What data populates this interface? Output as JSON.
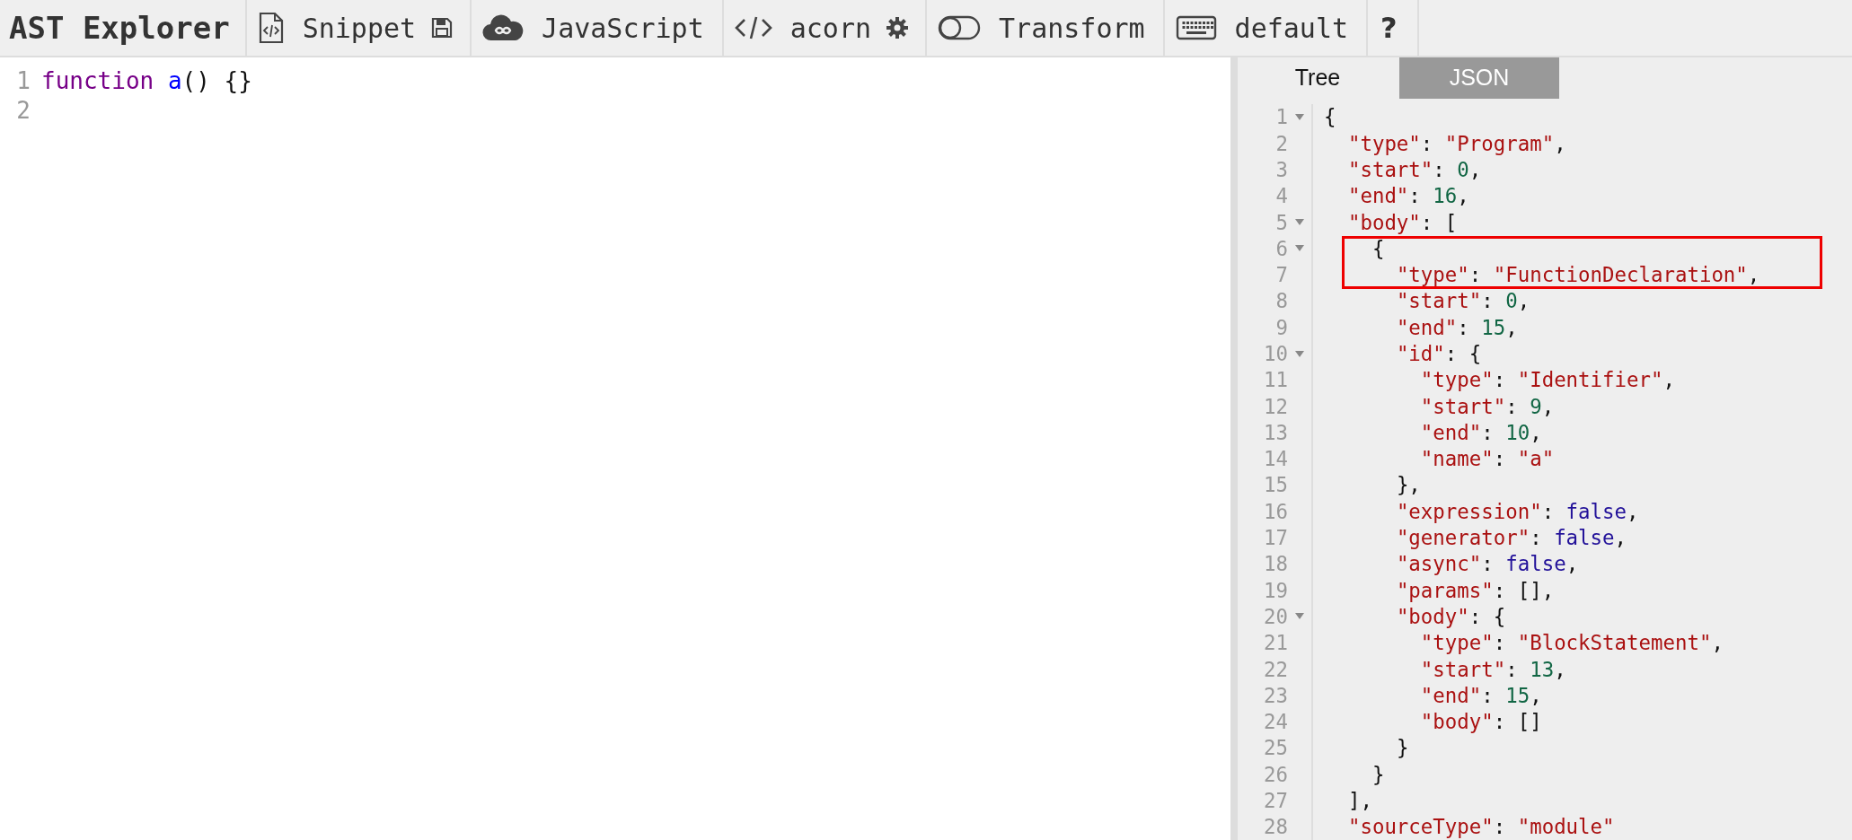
{
  "toolbar": {
    "logo": "AST Explorer",
    "items": [
      {
        "kind": "snippet",
        "label": "Snippet"
      },
      {
        "kind": "language",
        "label": "JavaScript"
      },
      {
        "kind": "parser",
        "label": "acorn"
      },
      {
        "kind": "transform",
        "label": "Transform",
        "on": false
      },
      {
        "kind": "keymap",
        "label": "default"
      },
      {
        "kind": "help",
        "label": "?"
      }
    ]
  },
  "editor": {
    "lines": [
      {
        "number": "1",
        "tokens": [
          {
            "kind": "keyword",
            "text": "function"
          },
          {
            "kind": "def",
            "text": "a"
          },
          {
            "kind": "p",
            "text": "() {}"
          }
        ]
      },
      {
        "number": "2"
      }
    ]
  },
  "output": {
    "tabs": [
      {
        "label": "Tree",
        "selected": false
      },
      {
        "label": "JSON",
        "selected": true
      }
    ],
    "lines": [
      {
        "number": "1",
        "foldable": true,
        "tokens": [
          {
            "kind": "p",
            "text": "{"
          }
        ],
        "children": [
          {
            "number": "2",
            "tokens": [
              {
                "kind": "key",
                "text": "\"type\""
              },
              {
                "kind": "p",
                "text": ": "
              },
              {
                "kind": "str",
                "text": "\"Program\""
              },
              {
                "kind": "p",
                "text": ","
              }
            ]
          },
          {
            "number": "3",
            "tokens": [
              {
                "kind": "key",
                "text": "\"start\""
              },
              {
                "kind": "p",
                "text": ": "
              },
              {
                "kind": "num",
                "text": "0"
              },
              {
                "kind": "p",
                "text": ","
              }
            ]
          },
          {
            "number": "4",
            "tokens": [
              {
                "kind": "key",
                "text": "\"end\""
              },
              {
                "kind": "p",
                "text": ": "
              },
              {
                "kind": "num",
                "text": "16"
              },
              {
                "kind": "p",
                "text": ","
              }
            ]
          },
          {
            "number": "5",
            "foldable": true,
            "tokens": [
              {
                "kind": "key",
                "text": "\"body\""
              },
              {
                "kind": "p",
                "text": ": ["
              }
            ],
            "children": [
              {
                "number": "6",
                "foldable": true,
                "highlighted": true,
                "tokens": [
                  {
                    "kind": "p",
                    "text": "{"
                  }
                ],
                "children": [
                  {
                    "number": "7",
                    "highlighted": true,
                    "tokens": [
                      {
                        "kind": "key",
                        "text": "\"type\""
                      },
                      {
                        "kind": "p",
                        "text": ": "
                      },
                      {
                        "kind": "str",
                        "text": "\"FunctionDeclaration\""
                      },
                      {
                        "kind": "p",
                        "text": ","
                      }
                    ]
                  },
                  {
                    "number": "8",
                    "tokens": [
                      {
                        "kind": "key",
                        "text": "\"start\""
                      },
                      {
                        "kind": "p",
                        "text": ": "
                      },
                      {
                        "kind": "num",
                        "text": "0"
                      },
                      {
                        "kind": "p",
                        "text": ","
                      }
                    ]
                  },
                  {
                    "number": "9",
                    "tokens": [
                      {
                        "kind": "key",
                        "text": "\"end\""
                      },
                      {
                        "kind": "p",
                        "text": ": "
                      },
                      {
                        "kind": "num",
                        "text": "15"
                      },
                      {
                        "kind": "p",
                        "text": ","
                      }
                    ]
                  },
                  {
                    "number": "10",
                    "foldable": true,
                    "tokens": [
                      {
                        "kind": "key",
                        "text": "\"id\""
                      },
                      {
                        "kind": "p",
                        "text": ": {"
                      }
                    ],
                    "children": [
                      {
                        "number": "11",
                        "tokens": [
                          {
                            "kind": "key",
                            "text": "\"type\""
                          },
                          {
                            "kind": "p",
                            "text": ": "
                          },
                          {
                            "kind": "str",
                            "text": "\"Identifier\""
                          },
                          {
                            "kind": "p",
                            "text": ","
                          }
                        ]
                      },
                      {
                        "number": "12",
                        "tokens": [
                          {
                            "kind": "key",
                            "text": "\"start\""
                          },
                          {
                            "kind": "p",
                            "text": ": "
                          },
                          {
                            "kind": "num",
                            "text": "9"
                          },
                          {
                            "kind": "p",
                            "text": ","
                          }
                        ]
                      },
                      {
                        "number": "13",
                        "tokens": [
                          {
                            "kind": "key",
                            "text": "\"end\""
                          },
                          {
                            "kind": "p",
                            "text": ": "
                          },
                          {
                            "kind": "num",
                            "text": "10"
                          },
                          {
                            "kind": "p",
                            "text": ","
                          }
                        ]
                      },
                      {
                        "number": "14",
                        "tokens": [
                          {
                            "kind": "key",
                            "text": "\"name\""
                          },
                          {
                            "kind": "p",
                            "text": ": "
                          },
                          {
                            "kind": "str",
                            "text": "\"a\""
                          }
                        ]
                      }
                    ]
                  },
                  {
                    "number": "15",
                    "tokens": [
                      {
                        "kind": "p",
                        "text": "},"
                      }
                    ]
                  },
                  {
                    "number": "16",
                    "tokens": [
                      {
                        "kind": "key",
                        "text": "\"expression\""
                      },
                      {
                        "kind": "p",
                        "text": ": "
                      },
                      {
                        "kind": "atom",
                        "text": "false"
                      },
                      {
                        "kind": "p",
                        "text": ","
                      }
                    ]
                  },
                  {
                    "number": "17",
                    "tokens": [
                      {
                        "kind": "key",
                        "text": "\"generator\""
                      },
                      {
                        "kind": "p",
                        "text": ": "
                      },
                      {
                        "kind": "atom",
                        "text": "false"
                      },
                      {
                        "kind": "p",
                        "text": ","
                      }
                    ]
                  },
                  {
                    "number": "18",
                    "tokens": [
                      {
                        "kind": "key",
                        "text": "\"async\""
                      },
                      {
                        "kind": "p",
                        "text": ": "
                      },
                      {
                        "kind": "atom",
                        "text": "false"
                      },
                      {
                        "kind": "p",
                        "text": ","
                      }
                    ]
                  },
                  {
                    "number": "19",
                    "tokens": [
                      {
                        "kind": "key",
                        "text": "\"params\""
                      },
                      {
                        "kind": "p",
                        "text": ": [],"
                      }
                    ]
                  },
                  {
                    "number": "20",
                    "foldable": true,
                    "tokens": [
                      {
                        "kind": "key",
                        "text": "\"body\""
                      },
                      {
                        "kind": "p",
                        "text": ": {"
                      }
                    ],
                    "children": [
                      {
                        "number": "21",
                        "tokens": [
                          {
                            "kind": "key",
                            "text": "\"type\""
                          },
                          {
                            "kind": "p",
                            "text": ": "
                          },
                          {
                            "kind": "str",
                            "text": "\"BlockStatement\""
                          },
                          {
                            "kind": "p",
                            "text": ","
                          }
                        ]
                      },
                      {
                        "number": "22",
                        "tokens": [
                          {
                            "kind": "key",
                            "text": "\"start\""
                          },
                          {
                            "kind": "p",
                            "text": ": "
                          },
                          {
                            "kind": "num",
                            "text": "13"
                          },
                          {
                            "kind": "p",
                            "text": ","
                          }
                        ]
                      },
                      {
                        "number": "23",
                        "tokens": [
                          {
                            "kind": "key",
                            "text": "\"end\""
                          },
                          {
                            "kind": "p",
                            "text": ": "
                          },
                          {
                            "kind": "num",
                            "text": "15"
                          },
                          {
                            "kind": "p",
                            "text": ","
                          }
                        ]
                      },
                      {
                        "number": "24",
                        "tokens": [
                          {
                            "kind": "key",
                            "text": "\"body\""
                          },
                          {
                            "kind": "p",
                            "text": ": []"
                          }
                        ]
                      }
                    ]
                  },
                  {
                    "number": "25",
                    "tokens": [
                      {
                        "kind": "p",
                        "text": "}"
                      }
                    ]
                  }
                ]
              },
              {
                "number": "26",
                "tokens": [
                  {
                    "kind": "p",
                    "text": "}"
                  }
                ]
              }
            ]
          },
          {
            "number": "27",
            "tokens": [
              {
                "kind": "p",
                "text": "],"
              }
            ]
          },
          {
            "number": "28",
            "tokens": [
              {
                "kind": "key",
                "text": "\"sourceType\""
              },
              {
                "kind": "p",
                "text": ": "
              },
              {
                "kind": "str",
                "text": "\"module\""
              }
            ]
          }
        ]
      }
    ]
  }
}
